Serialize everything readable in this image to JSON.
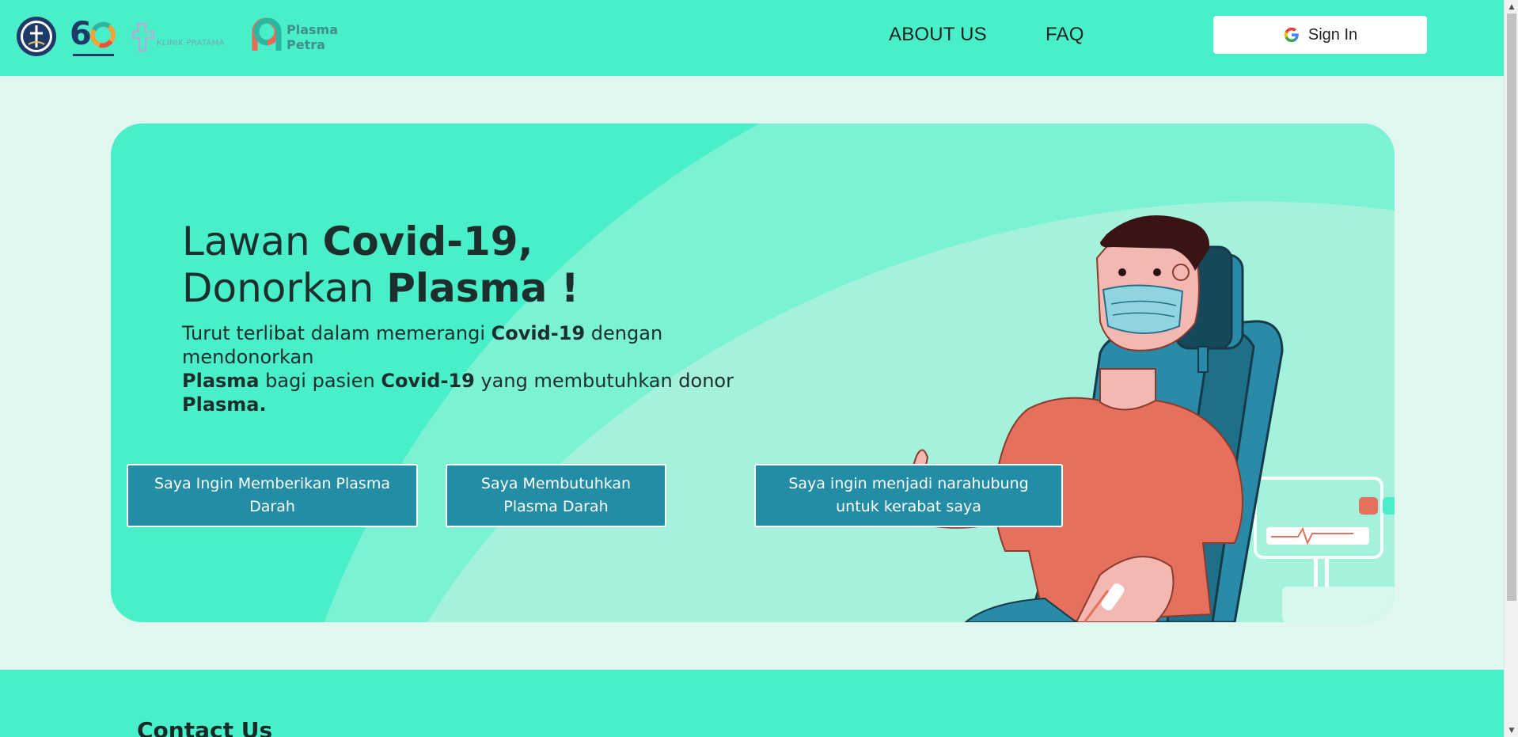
{
  "header": {
    "nav": [
      {
        "label": "ABOUT US"
      },
      {
        "label": "FAQ"
      }
    ],
    "signin_label": "Sign In",
    "logos": {
      "klinik_text": "KLINIK PRATAMA",
      "plasma_line1": "Plasma",
      "plasma_line2": "Petra"
    }
  },
  "hero": {
    "title_line1_regular": "Lawan ",
    "title_line1_bold": "Covid-19,",
    "title_line2_regular": "Donorkan ",
    "title_line2_bold": "Plasma !",
    "sub_part1": "Turut terlibat dalam memerangi ",
    "sub_bold1": "Covid-19",
    "sub_part2": " dengan mendonorkan ",
    "sub_bold2": "Plasma",
    "sub_part3": " bagi pasien ",
    "sub_bold3": "Covid-19",
    "sub_part4": " yang membutuhkan donor ",
    "sub_bold4": "Plasma.",
    "buttons": [
      {
        "label": "Saya Ingin Memberikan Plasma Darah"
      },
      {
        "label": "Saya Membutuhkan Plasma Darah"
      },
      {
        "label": "Saya ingin menjadi narahubung untuk kerabat saya"
      }
    ]
  },
  "footer": {
    "contact_title": "Contact Us"
  },
  "colors": {
    "header_bg": "#48efc9",
    "page_bg": "#e0f7ef",
    "button_bg": "#248da6",
    "shirt": "#e4705d",
    "chair": "#2a8ba8"
  }
}
